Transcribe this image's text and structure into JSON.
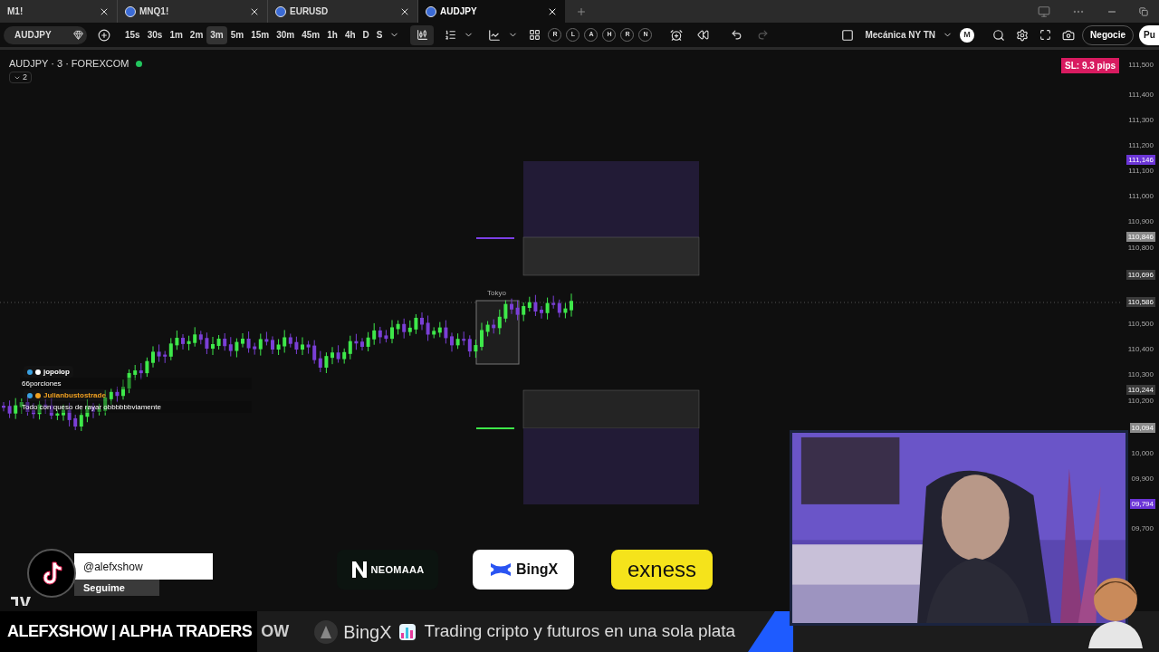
{
  "tabs": [
    {
      "label": "M1!",
      "selected": false
    },
    {
      "label": "MNQ1!",
      "selected": false
    },
    {
      "label": "EURUSD",
      "selected": false
    },
    {
      "label": "AUDJPY",
      "selected": true
    }
  ],
  "toolbar": {
    "symbol": "AUDJPY",
    "intervals": [
      {
        "label": "15s",
        "selected": false
      },
      {
        "label": "30s",
        "selected": false
      },
      {
        "label": "1m",
        "selected": false
      },
      {
        "label": "2m",
        "selected": false
      },
      {
        "label": "3m",
        "selected": true
      },
      {
        "label": "5m",
        "selected": false
      },
      {
        "label": "15m",
        "selected": false
      },
      {
        "label": "30m",
        "selected": false
      },
      {
        "label": "45m",
        "selected": false
      },
      {
        "label": "1h",
        "selected": false
      },
      {
        "label": "4h",
        "selected": false
      },
      {
        "label": "D",
        "selected": false
      },
      {
        "label": "S",
        "selected": false
      }
    ],
    "markers": [
      "R",
      "L",
      "A",
      "H",
      "R",
      "N"
    ],
    "layout_name": "Mecánica NY TN",
    "avatar": "M",
    "trade_button": "Negocie",
    "cut_button": "Pu"
  },
  "chart": {
    "legend": "AUDJPY · 3 · FOREXCOM",
    "indicator_count": "2",
    "sl_badge": "SL: 9.3 pips",
    "session_label": "Tokyo",
    "price_axis": [
      {
        "label": "111,500",
        "kind": "tick"
      },
      {
        "label": "111,400",
        "kind": "tick"
      },
      {
        "label": "111,300",
        "kind": "tick"
      },
      {
        "label": "111,200",
        "kind": "tick"
      },
      {
        "label": "111,146",
        "kind": "badge",
        "color": "#6b35d6"
      },
      {
        "label": "111,100",
        "kind": "tick"
      },
      {
        "label": "111,000",
        "kind": "tick"
      },
      {
        "label": "110,900",
        "kind": "tick"
      },
      {
        "label": "110,846",
        "kind": "badge",
        "color": "#8a8a8a"
      },
      {
        "label": "110,800",
        "kind": "tick"
      },
      {
        "label": "110,696",
        "kind": "badge",
        "color": "#3a3a3a"
      },
      {
        "label": "110,586",
        "kind": "badge",
        "color": "#3a3a3a"
      },
      {
        "label": "110,500",
        "kind": "tick"
      },
      {
        "label": "110,400",
        "kind": "tick"
      },
      {
        "label": "110,300",
        "kind": "tick"
      },
      {
        "label": "110,244",
        "kind": "badge",
        "color": "#3a3a3a"
      },
      {
        "label": "110,200",
        "kind": "tick"
      },
      {
        "label": "10,094",
        "kind": "badge",
        "color": "#8a8a8a"
      },
      {
        "label": "10,000",
        "kind": "tick"
      },
      {
        "label": "09,900",
        "kind": "tick"
      },
      {
        "label": "09,794",
        "kind": "badge",
        "color": "#6b35d6"
      },
      {
        "label": "09,700",
        "kind": "tick"
      }
    ]
  },
  "chat": [
    {
      "user": "jopolop",
      "color": "#ffffff",
      "message": "66porciones"
    },
    {
      "user": "Julianbustostrade",
      "color": "#f0a020",
      "message": "Todo con queso de rayar obbbbbbviamente"
    }
  ],
  "social": {
    "handle": "@alefxshow",
    "action": "Seguime"
  },
  "sponsors": [
    {
      "name": "NEOMAAA",
      "kind": "neomaaa"
    },
    {
      "name": "BingX",
      "kind": "bingx"
    },
    {
      "name": "exness",
      "kind": "exness"
    }
  ],
  "ticker": {
    "title": "ALEFXSHOW | ALPHA TRADERS",
    "fragment": "OW",
    "brand": "BingX",
    "message": "Trading cripto y futuros en una sola plata"
  }
}
